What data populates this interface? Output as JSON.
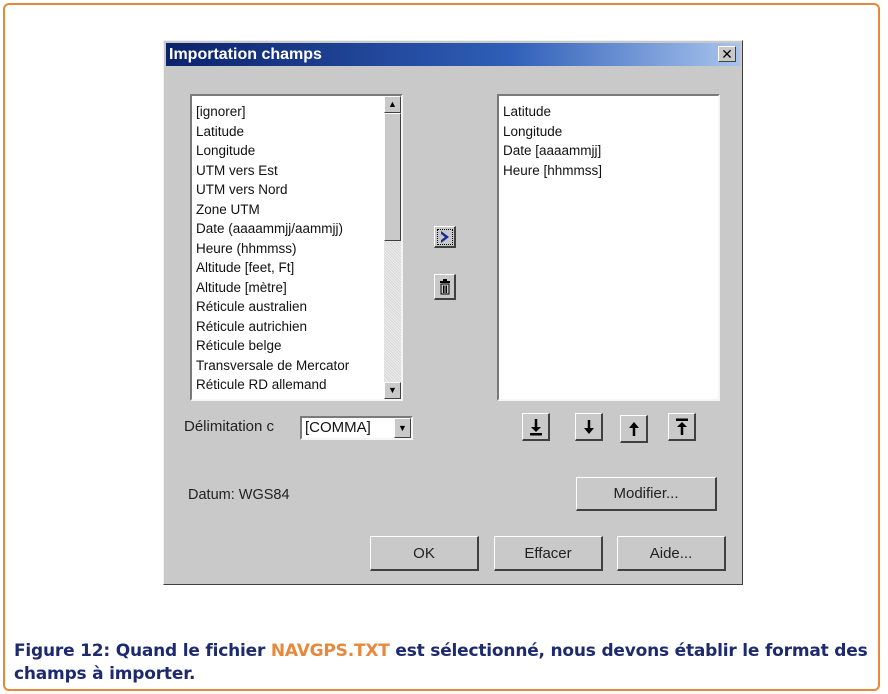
{
  "dialog": {
    "title": "Importation champs",
    "close_glyph": "✕",
    "available_fields": [
      "[ignorer]",
      "Latitude",
      "Longitude",
      "UTM vers Est",
      "UTM vers Nord",
      "Zone UTM",
      "Date (aaaammjj/aammjj)",
      "Heure (hhmmss)",
      "Altitude [feet, Ft]",
      "Altitude [mètre]",
      "Réticule australien",
      "Réticule autrichien",
      "Réticule belge",
      "Transversale de Mercator",
      "Réticule RD allemand"
    ],
    "selected_fields": [
      "Latitude",
      "Longitude",
      "Date [aaaammjj]",
      "Heure [hhmmss]"
    ],
    "add_button_icon": "chevron-right-icon",
    "delete_button_icon": "trash-icon",
    "delimiter_label": "Délimitation c",
    "delimiter_value": "[COMMA]",
    "order_buttons": [
      "move-bottom-icon",
      "move-down-icon",
      "move-up-icon",
      "move-top-icon"
    ],
    "datum_label": "Datum: WGS84",
    "modify_button": "Modifier...",
    "ok_button": "OK",
    "clear_button": "Effacer",
    "help_button": "Aide..."
  },
  "caption": {
    "prefix": "Figure 12: Quand le fichier ",
    "filename": "NAVGPS.TXT",
    "suffix": " est sélectionné, nous devons établir le format des champs à importer."
  },
  "colors": {
    "frame_border": "#e8883a",
    "caption_text": "#1e2a6e",
    "caption_highlight": "#e8883a",
    "title_bar": "#0c226b",
    "dialog_face": "#c9c9c9"
  }
}
